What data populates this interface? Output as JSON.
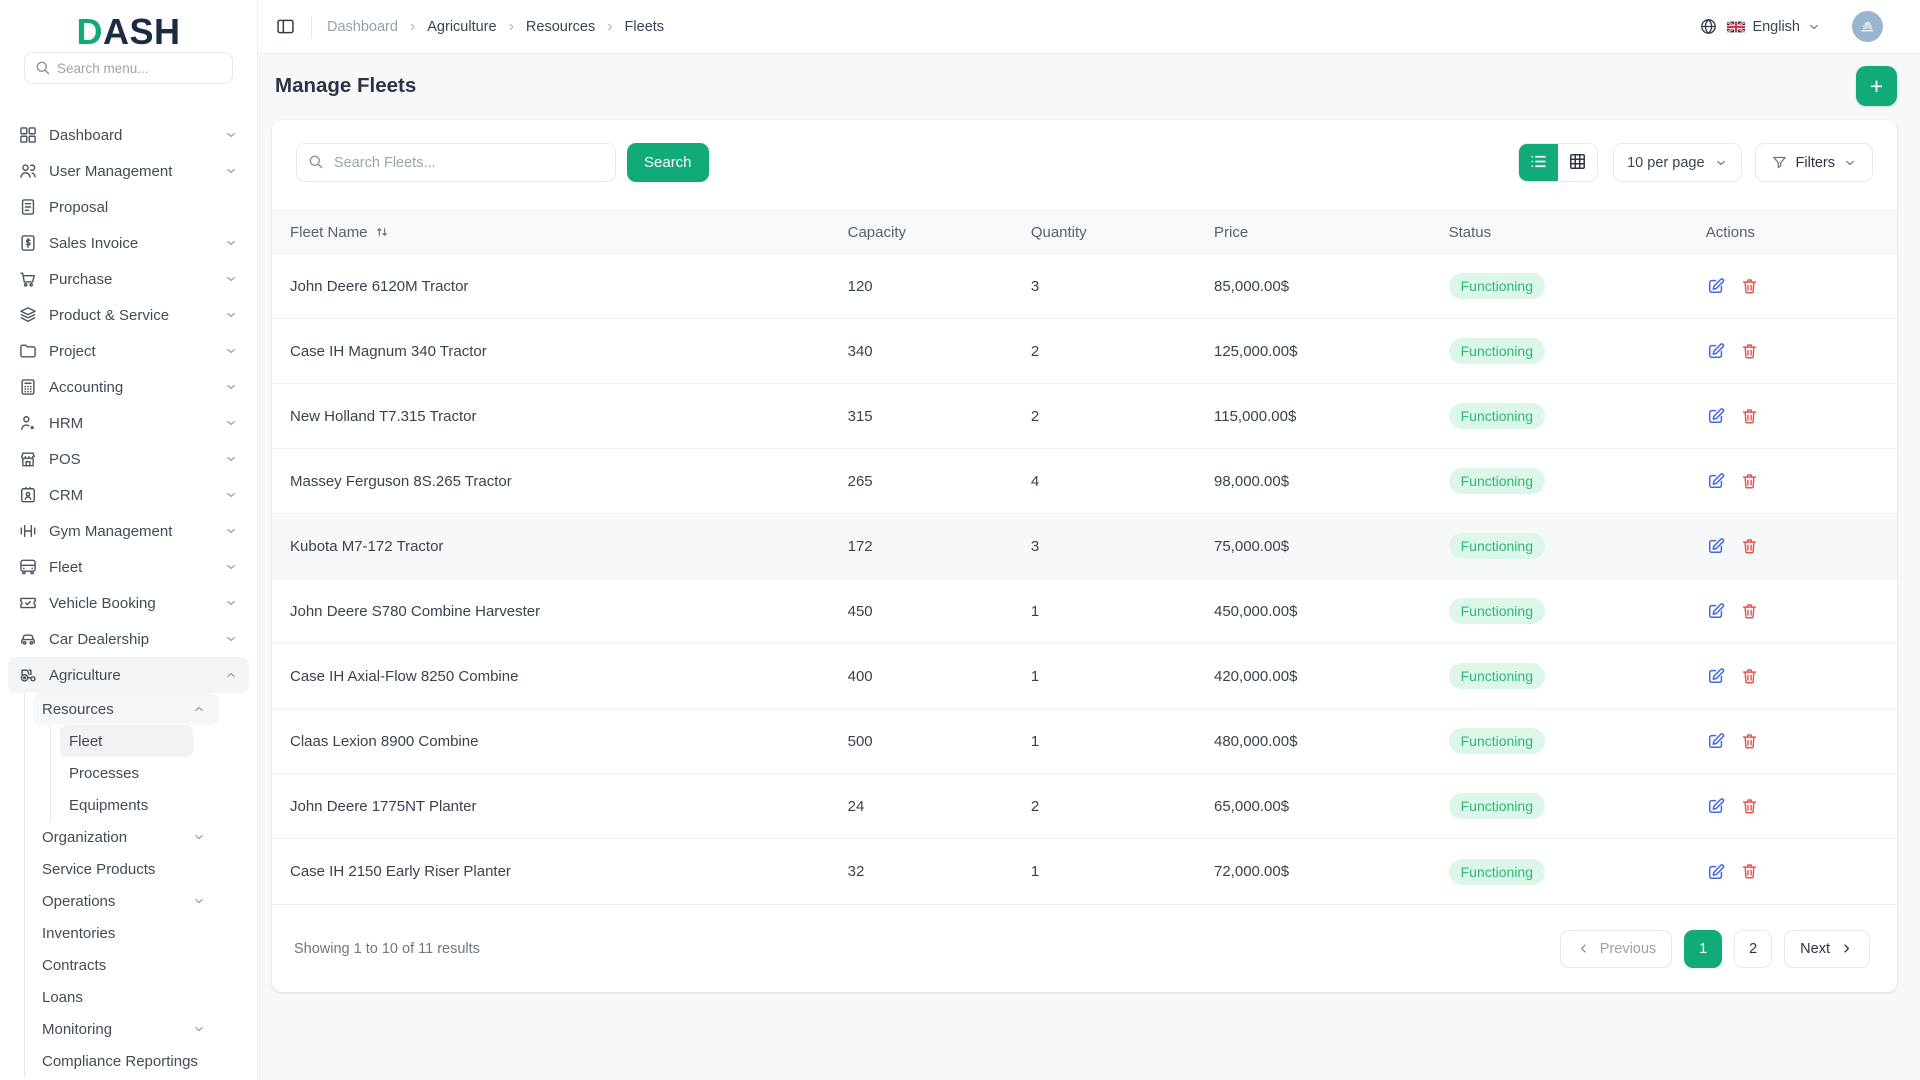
{
  "brand": {
    "name_accent": "D",
    "name_rest": "ASH"
  },
  "sidebar": {
    "search_placeholder": "Search menu...",
    "menu": [
      {
        "label": "Dashboard",
        "icon": "grid",
        "chevron": "down"
      },
      {
        "label": "User Management",
        "icon": "users",
        "chevron": "down"
      },
      {
        "label": "Proposal",
        "icon": "clipboard",
        "chevron": null
      },
      {
        "label": "Sales Invoice",
        "icon": "invoice",
        "chevron": "down"
      },
      {
        "label": "Purchase",
        "icon": "cart",
        "chevron": "down"
      },
      {
        "label": "Product & Service",
        "icon": "layers",
        "chevron": "down"
      },
      {
        "label": "Project",
        "icon": "folder",
        "chevron": "down"
      },
      {
        "label": "Accounting",
        "icon": "calculator",
        "chevron": "down"
      },
      {
        "label": "HRM",
        "icon": "person",
        "chevron": "down"
      },
      {
        "label": "POS",
        "icon": "store",
        "chevron": "down"
      },
      {
        "label": "CRM",
        "icon": "idcard",
        "chevron": "down"
      },
      {
        "label": "Gym Management",
        "icon": "dumbbell",
        "chevron": "down"
      },
      {
        "label": "Fleet",
        "icon": "bus",
        "chevron": "down"
      },
      {
        "label": "Vehicle Booking",
        "icon": "ticket",
        "chevron": "down"
      },
      {
        "label": "Car Dealership",
        "icon": "car",
        "chevron": "down"
      },
      {
        "label": "Agriculture",
        "icon": "tractor",
        "chevron": "up",
        "active": true,
        "children": [
          {
            "label": "Resources",
            "chevron": "up",
            "expanded": true,
            "children": [
              {
                "label": "Fleet",
                "active": true
              },
              {
                "label": "Processes"
              },
              {
                "label": "Equipments"
              }
            ]
          },
          {
            "label": "Organization",
            "chevron": "down"
          },
          {
            "label": "Service Products"
          },
          {
            "label": "Operations",
            "chevron": "down"
          },
          {
            "label": "Inventories"
          },
          {
            "label": "Contracts"
          },
          {
            "label": "Loans"
          },
          {
            "label": "Monitoring",
            "chevron": "down"
          },
          {
            "label": "Compliance Reportings"
          }
        ]
      }
    ]
  },
  "header": {
    "breadcrumb": [
      "Dashboard",
      "Agriculture",
      "Resources",
      "Fleets"
    ],
    "language": "English"
  },
  "page": {
    "title": "Manage Fleets",
    "add_button": "+"
  },
  "toolbar": {
    "search_placeholder": "Search Fleets...",
    "search_button": "Search",
    "per_page": "10 per page",
    "filters_label": "Filters",
    "active_view": "list"
  },
  "table": {
    "columns": [
      {
        "label": "Fleet Name",
        "sortable": true
      },
      {
        "label": "Capacity"
      },
      {
        "label": "Quantity"
      },
      {
        "label": "Price"
      },
      {
        "label": "Status"
      },
      {
        "label": "Actions"
      }
    ],
    "rows": [
      {
        "name": "John Deere 6120M Tractor",
        "capacity": "120",
        "quantity": "3",
        "price": "85,000.00$",
        "status": "Functioning"
      },
      {
        "name": "Case IH Magnum 340 Tractor",
        "capacity": "340",
        "quantity": "2",
        "price": "125,000.00$",
        "status": "Functioning"
      },
      {
        "name": "New Holland T7.315 Tractor",
        "capacity": "315",
        "quantity": "2",
        "price": "115,000.00$",
        "status": "Functioning"
      },
      {
        "name": "Massey Ferguson 8S.265 Tractor",
        "capacity": "265",
        "quantity": "4",
        "price": "98,000.00$",
        "status": "Functioning"
      },
      {
        "name": "Kubota M7-172 Tractor",
        "capacity": "172",
        "quantity": "3",
        "price": "75,000.00$",
        "status": "Functioning",
        "highlighted": true
      },
      {
        "name": "John Deere S780 Combine Harvester",
        "capacity": "450",
        "quantity": "1",
        "price": "450,000.00$",
        "status": "Functioning"
      },
      {
        "name": "Case IH Axial-Flow 8250 Combine",
        "capacity": "400",
        "quantity": "1",
        "price": "420,000.00$",
        "status": "Functioning"
      },
      {
        "name": "Claas Lexion 8900 Combine",
        "capacity": "500",
        "quantity": "1",
        "price": "480,000.00$",
        "status": "Functioning"
      },
      {
        "name": "John Deere 1775NT Planter",
        "capacity": "24",
        "quantity": "2",
        "price": "65,000.00$",
        "status": "Functioning"
      },
      {
        "name": "Case IH 2150 Early Riser Planter",
        "capacity": "32",
        "quantity": "1",
        "price": "72,000.00$",
        "status": "Functioning"
      }
    ]
  },
  "pagination": {
    "summary": "Showing 1 to 10 of 11 results",
    "previous": "Previous",
    "next": "Next",
    "pages": [
      "1",
      "2"
    ],
    "active_page": "1"
  },
  "colors": {
    "accent": "#10ab78",
    "navy": "#1a2b42",
    "badge_bg": "#dcf7ea",
    "badge_text": "#2eb872",
    "edit": "#4169e1",
    "danger": "#e25650",
    "avatar": "#9ab5cf"
  }
}
